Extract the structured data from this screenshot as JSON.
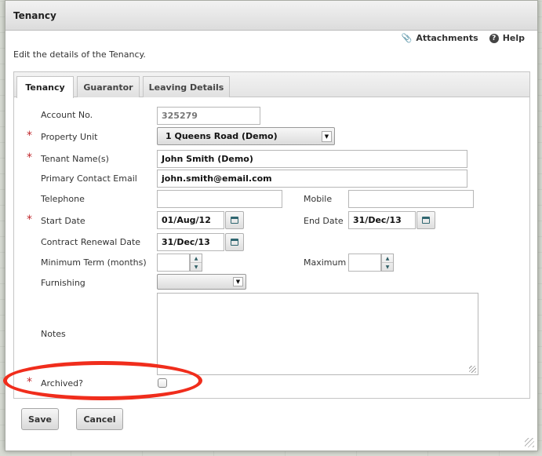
{
  "dialog": {
    "title": "Tenancy",
    "intro": "Edit the details of the Tenancy.",
    "links": {
      "attachments": "Attachments",
      "help": "Help",
      "help_glyph": "?"
    }
  },
  "tabs": [
    "Tenancy",
    "Guarantor",
    "Leaving Details"
  ],
  "form": {
    "account_no": {
      "label": "Account No.",
      "value": "325279"
    },
    "property_unit": {
      "label": "Property Unit",
      "value": "1 Queens Road (Demo)"
    },
    "tenant_names": {
      "label": "Tenant Name(s)",
      "value": "John Smith (Demo)"
    },
    "primary_email": {
      "label": "Primary Contact Email",
      "value": "john.smith@email.com"
    },
    "telephone": {
      "label": "Telephone",
      "value": ""
    },
    "mobile": {
      "label": "Mobile",
      "value": ""
    },
    "start_date": {
      "label": "Start Date",
      "value": "01/Aug/12"
    },
    "end_date": {
      "label": "End Date",
      "value": "31/Dec/13"
    },
    "contract_renewal": {
      "label": "Contract Renewal Date",
      "value": "31/Dec/13"
    },
    "minimum_term": {
      "label": "Minimum Term (months)",
      "value": ""
    },
    "maximum": {
      "label": "Maximum",
      "value": ""
    },
    "furnishing": {
      "label": "Furnishing",
      "value": ""
    },
    "notes": {
      "label": "Notes",
      "value": ""
    },
    "archived": {
      "label": "Archived?",
      "checked": false
    }
  },
  "buttons": {
    "save": "Save",
    "cancel": "Cancel"
  },
  "required_marker": "*",
  "colors": {
    "required": "#c0282c",
    "annotation": "#f02d1c"
  }
}
